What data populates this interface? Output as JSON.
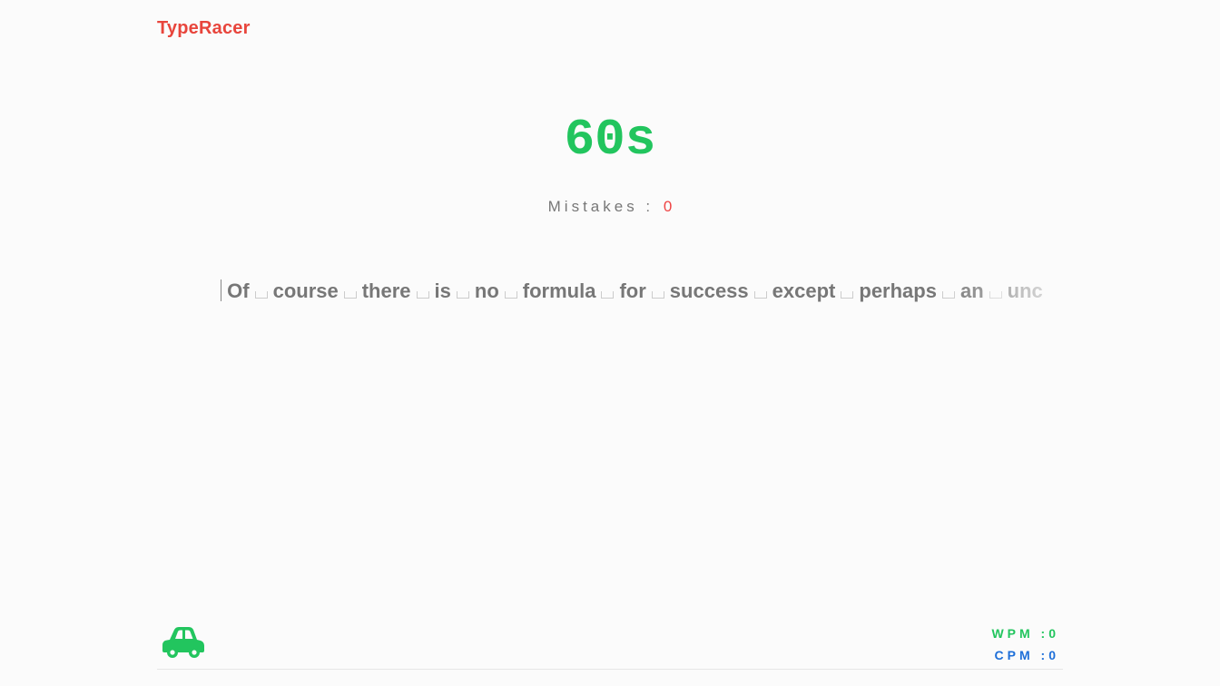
{
  "app": {
    "logo": "TypeRacer"
  },
  "timer": {
    "display": "60s"
  },
  "mistakes": {
    "label": "Mistakes :",
    "count": "0"
  },
  "passage": {
    "words": [
      "Of",
      "course",
      "there",
      "is",
      "no",
      "formula",
      "for",
      "success",
      "except",
      "perhaps",
      "an",
      "unc"
    ]
  },
  "stats": {
    "wpm_label": "WPM",
    "wpm_value": ":0",
    "cpm_label": "CPM",
    "cpm_value": ":0"
  },
  "icons": {
    "car": "car-icon"
  },
  "colors": {
    "logo": "#e8453c",
    "timer": "#22c55e",
    "mistakes_count": "#ef4444",
    "wpm": "#22c55e",
    "cpm": "#1e6fd9",
    "car": "#22c55e"
  }
}
